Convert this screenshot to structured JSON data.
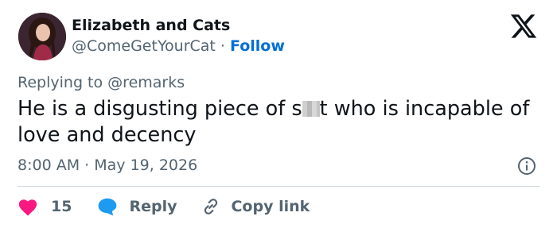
{
  "author": {
    "name": "Elizabeth and Cats",
    "handle": "@ComeGetYourCat",
    "separator": "·",
    "follow_label": "Follow"
  },
  "reply_to": {
    "prefix": "Replying to",
    "mention": "@remarks"
  },
  "tweet": {
    "text_before": "He is a disgusting piece of s",
    "text_after": "t who is incapable of love and decency"
  },
  "meta": {
    "time": "8:00 AM",
    "separator": "·",
    "date": "May 19, 2026"
  },
  "actions": {
    "like_count": "15",
    "reply_label": "Reply",
    "copy_label": "Copy link"
  },
  "colors": {
    "like": "#f91880",
    "reply": "#1d9bf0",
    "follow": "#006fd6",
    "muted": "#536471",
    "text": "#0f1419"
  },
  "icons": [
    "x-logo-icon",
    "info-icon",
    "heart-icon",
    "speech-bubble-icon",
    "link-icon"
  ]
}
